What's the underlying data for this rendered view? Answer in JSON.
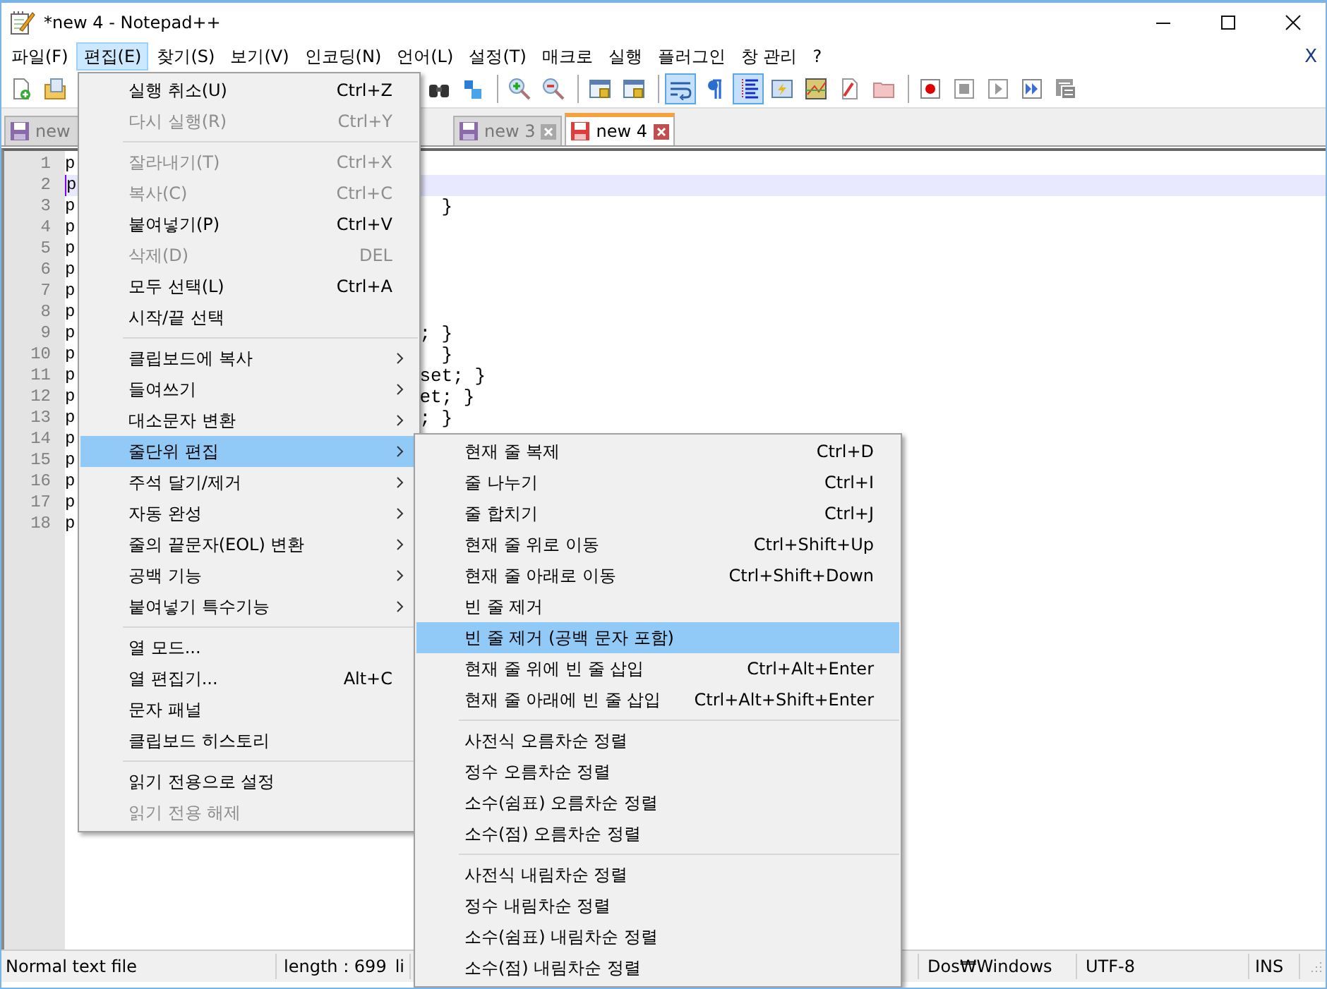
{
  "window": {
    "title": "*new 4 - Notepad++"
  },
  "menu_bar": {
    "items": [
      {
        "label": "파일(F)",
        "selected": false
      },
      {
        "label": "편집(E)",
        "selected": true
      },
      {
        "label": "찾기(S)",
        "selected": false
      },
      {
        "label": "보기(V)",
        "selected": false
      },
      {
        "label": "인코딩(N)",
        "selected": false
      },
      {
        "label": "언어(L)",
        "selected": false
      },
      {
        "label": "설정(T)",
        "selected": false
      },
      {
        "label": "매크로",
        "selected": false
      },
      {
        "label": "실행",
        "selected": false
      },
      {
        "label": "플러그인",
        "selected": false
      },
      {
        "label": "창 관리",
        "selected": false
      },
      {
        "label": "?",
        "selected": false
      }
    ],
    "close_label": "X"
  },
  "toolbar_left": [
    {
      "kind": "new",
      "pressed": false
    },
    {
      "kind": "open",
      "pressed": false
    }
  ],
  "toolbar_right": [
    {
      "kind": "find",
      "pressed": false
    },
    {
      "kind": "replace",
      "pressed": false
    },
    {
      "kind": "separator"
    },
    {
      "kind": "zoom-in",
      "pressed": false
    },
    {
      "kind": "zoom-out",
      "pressed": false
    },
    {
      "kind": "separator"
    },
    {
      "kind": "sync-v",
      "pressed": false
    },
    {
      "kind": "sync-h",
      "pressed": false
    },
    {
      "kind": "separator"
    },
    {
      "kind": "wrap",
      "pressed": true
    },
    {
      "kind": "pilcrow",
      "pressed": false
    },
    {
      "kind": "indent",
      "pressed": true
    },
    {
      "kind": "window",
      "pressed": false
    },
    {
      "kind": "map",
      "pressed": false
    },
    {
      "kind": "doc",
      "pressed": false
    },
    {
      "kind": "folder",
      "pressed": false
    },
    {
      "kind": "separator"
    },
    {
      "kind": "record",
      "pressed": false
    },
    {
      "kind": "stop",
      "pressed": false
    },
    {
      "kind": "play",
      "pressed": false
    },
    {
      "kind": "play-multi",
      "pressed": false
    },
    {
      "kind": "save-macro",
      "pressed": false
    }
  ],
  "tabs": [
    {
      "label": "new",
      "selected": false,
      "modified": false
    },
    {
      "label": "new 3",
      "selected": false,
      "modified": false
    },
    {
      "label": "new 4",
      "selected": true,
      "modified": true
    }
  ],
  "editor": {
    "lines": [
      {
        "number": "1",
        "start": "p",
        "current": false
      },
      {
        "number": "2",
        "start": "p",
        "current": true
      },
      {
        "number": "3",
        "start": "p",
        "tail": "  }",
        "current": false
      },
      {
        "number": "4",
        "start": "p",
        "current": false
      },
      {
        "number": "5",
        "start": "p",
        "current": false
      },
      {
        "number": "6",
        "start": "p",
        "current": false
      },
      {
        "number": "7",
        "start": "p",
        "current": false
      },
      {
        "number": "8",
        "start": "p",
        "current": false
      },
      {
        "number": "9",
        "start": "p",
        "tail": "; }",
        "current": false
      },
      {
        "number": "10",
        "start": "p",
        "tail": "  }",
        "current": false
      },
      {
        "number": "11",
        "start": "p",
        "tail": "set; }",
        "current": false
      },
      {
        "number": "12",
        "start": "p",
        "tail": "et; }",
        "current": false
      },
      {
        "number": "13",
        "start": "p",
        "tail": "; }",
        "current": false
      },
      {
        "number": "14",
        "start": "p",
        "current": false
      },
      {
        "number": "15",
        "start": "p",
        "current": false
      },
      {
        "number": "16",
        "start": "p",
        "current": false
      },
      {
        "number": "17",
        "start": "p",
        "current": false
      },
      {
        "number": "18",
        "start": "p",
        "current": false
      }
    ]
  },
  "edit_menu": {
    "groups": [
      [
        {
          "label": "실행 취소(U)",
          "shortcut": "Ctrl+Z",
          "disabled": false,
          "submenu": false,
          "selected": false
        },
        {
          "label": "다시 실행(R)",
          "shortcut": "Ctrl+Y",
          "disabled": true,
          "submenu": false,
          "selected": false
        }
      ],
      [
        {
          "label": "잘라내기(T)",
          "shortcut": "Ctrl+X",
          "disabled": true,
          "submenu": false,
          "selected": false
        },
        {
          "label": "복사(C)",
          "shortcut": "Ctrl+C",
          "disabled": true,
          "submenu": false,
          "selected": false
        },
        {
          "label": "붙여넣기(P)",
          "shortcut": "Ctrl+V",
          "disabled": false,
          "submenu": false,
          "selected": false
        },
        {
          "label": "삭제(D)",
          "shortcut": "DEL",
          "disabled": true,
          "submenu": false,
          "selected": false
        },
        {
          "label": "모두 선택(L)",
          "shortcut": "Ctrl+A",
          "disabled": false,
          "submenu": false,
          "selected": false
        },
        {
          "label": "시작/끝 선택",
          "disabled": false,
          "submenu": false,
          "selected": false
        }
      ],
      [
        {
          "label": "클립보드에 복사",
          "disabled": false,
          "submenu": true,
          "selected": false
        },
        {
          "label": "들여쓰기",
          "disabled": false,
          "submenu": true,
          "selected": false
        },
        {
          "label": "대소문자 변환",
          "disabled": false,
          "submenu": true,
          "selected": false
        },
        {
          "label": "줄단위 편집",
          "disabled": false,
          "submenu": true,
          "selected": true
        },
        {
          "label": "주석 달기/제거",
          "disabled": false,
          "submenu": true,
          "selected": false
        },
        {
          "label": "자동 완성",
          "disabled": false,
          "submenu": true,
          "selected": false
        },
        {
          "label": "줄의 끝문자(EOL) 변환",
          "disabled": false,
          "submenu": true,
          "selected": false
        },
        {
          "label": "공백 기능",
          "disabled": false,
          "submenu": true,
          "selected": false
        },
        {
          "label": "붙여넣기 특수기능",
          "disabled": false,
          "submenu": true,
          "selected": false
        }
      ],
      [
        {
          "label": "열 모드...",
          "disabled": false,
          "submenu": false,
          "selected": false
        },
        {
          "label": "열 편집기...",
          "shortcut": "Alt+C",
          "disabled": false,
          "submenu": false,
          "selected": false
        },
        {
          "label": "문자 패널",
          "disabled": false,
          "submenu": false,
          "selected": false
        },
        {
          "label": "클립보드 히스토리",
          "disabled": false,
          "submenu": false,
          "selected": false
        }
      ],
      [
        {
          "label": "읽기 전용으로 설정",
          "disabled": false,
          "submenu": false,
          "selected": false
        },
        {
          "label": "읽기 전용 해제",
          "disabled": true,
          "submenu": false,
          "selected": false
        }
      ]
    ]
  },
  "line_ops_submenu": {
    "groups": [
      [
        {
          "label": "현재 줄 복제",
          "shortcut": "Ctrl+D",
          "selected": false
        },
        {
          "label": "줄 나누기",
          "shortcut": "Ctrl+I",
          "selected": false
        },
        {
          "label": "줄 합치기",
          "shortcut": "Ctrl+J",
          "selected": false
        },
        {
          "label": "현재 줄 위로 이동",
          "shortcut": "Ctrl+Shift+Up",
          "selected": false
        },
        {
          "label": "현재 줄 아래로 이동",
          "shortcut": "Ctrl+Shift+Down",
          "selected": false
        },
        {
          "label": "빈 줄 제거",
          "selected": false
        },
        {
          "label": "빈 줄 제거 (공백 문자 포함)",
          "selected": true
        },
        {
          "label": "현재 줄 위에 빈 줄 삽입",
          "shortcut": "Ctrl+Alt+Enter",
          "selected": false
        },
        {
          "label": "현재 줄 아래에 빈 줄 삽입",
          "shortcut": "Ctrl+Alt+Shift+Enter",
          "selected": false
        }
      ],
      [
        {
          "label": "사전식 오름차순 정렬",
          "selected": false
        },
        {
          "label": "정수 오름차순 정렬",
          "selected": false
        },
        {
          "label": "소수(쉼표) 오름차순 정렬",
          "selected": false
        },
        {
          "label": "소수(점) 오름차순 정렬",
          "selected": false
        }
      ],
      [
        {
          "label": "사전식 내림차순 정렬",
          "selected": false
        },
        {
          "label": "정수 내림차순 정렬",
          "selected": false
        },
        {
          "label": "소수(쉼표) 내림차순 정렬",
          "selected": false
        },
        {
          "label": "소수(점) 내림차순 정렬",
          "selected": false
        }
      ]
    ]
  },
  "status_bar": {
    "file_type": "Normal text file",
    "length": "length : 699",
    "lines_cut": "li",
    "eol": "Dos₩Windows",
    "encoding": "UTF-8",
    "mode": "INS"
  }
}
